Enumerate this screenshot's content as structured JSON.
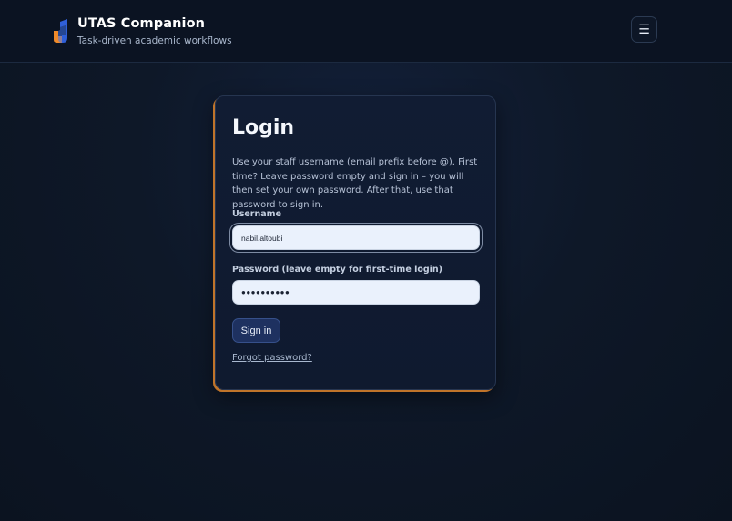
{
  "header": {
    "title": "UTAS Companion",
    "subtitle": "Task-driven academic workflows",
    "menu_icon": "☰",
    "logo_colors": {
      "orange": "#f08a2a",
      "blue": "#2f5fd8"
    }
  },
  "login": {
    "title": "Login",
    "description": "Use your staff username (email prefix before @). First time? Leave password empty and sign in – you will then set your own password. After that, use that password to sign in.",
    "username_label": "Username",
    "username_value": "nabil.altoubi",
    "password_label": "Password (leave empty for first-time login)",
    "password_value": "●●●●●●●●●●",
    "signin_label": "Sign in",
    "forgot_label": "Forgot password?"
  },
  "colors": {
    "accent_orange": "#c0742a",
    "button_bg": "#1e3160"
  }
}
